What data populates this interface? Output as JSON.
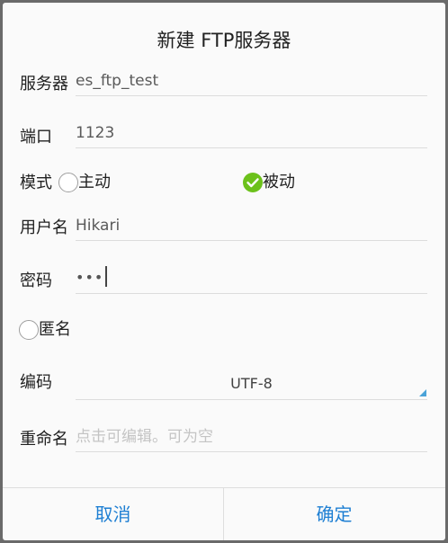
{
  "dialog": {
    "title": "新建 FTP服务器"
  },
  "form": {
    "server": {
      "label": "服务器",
      "value": "es_ftp_test"
    },
    "port": {
      "label": "端口",
      "value": "1123"
    },
    "mode": {
      "label": "模式",
      "options": [
        {
          "label": "主动",
          "selected": false
        },
        {
          "label": "被动",
          "selected": true
        }
      ]
    },
    "username": {
      "label": "用户名",
      "value": "Hikari"
    },
    "password": {
      "label": "密码",
      "masked_value": "•••"
    },
    "anonymous": {
      "label": "匿名",
      "checked": false
    },
    "encoding": {
      "label": "编码",
      "value": "UTF-8"
    },
    "rename": {
      "label": "重命名",
      "value": "",
      "placeholder": "点击可编辑。可为空"
    }
  },
  "footer": {
    "cancel_label": "取消",
    "ok_label": "确定"
  },
  "colors": {
    "accent": "#1e7fd3",
    "checked": "#6cc11b",
    "dropdown_arrow": "#4aa3d8"
  },
  "icons": {
    "mode_active": "radio-unchecked-icon",
    "mode_passive": "radio-checked-icon",
    "anonymous": "radio-unchecked-icon",
    "encoding": "dropdown-triangle-icon"
  }
}
